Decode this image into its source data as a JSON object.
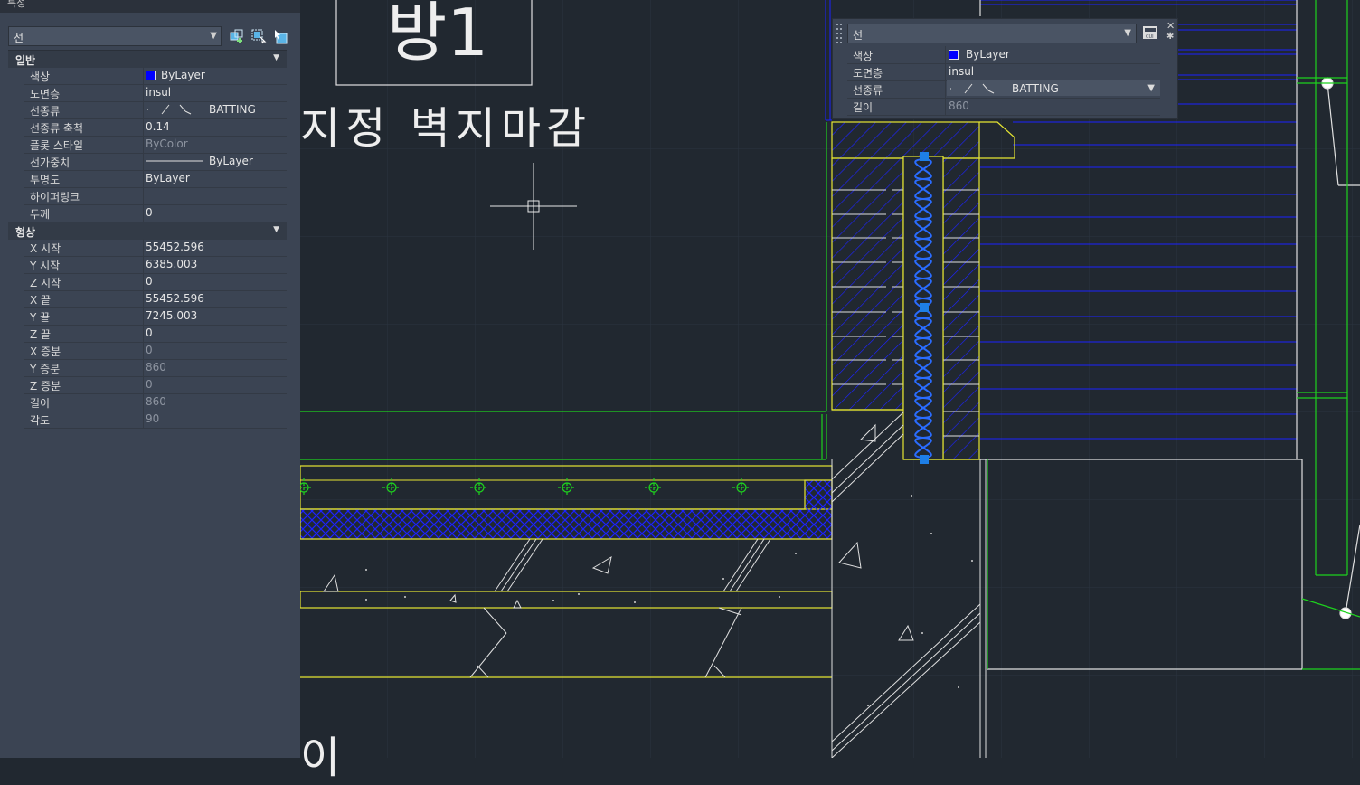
{
  "drawing": {
    "room_label": "방1",
    "wall_note": "지정 벽지마감",
    "partial_bottom_text": "이",
    "colors": {
      "background": "#212830",
      "layer_blue": "#1c22ff",
      "layer_yellow": "#e6e632",
      "layer_green": "#1ed21e",
      "white_lines": "#e0e0e0",
      "grip": "#1e7fe6"
    }
  },
  "properties_palette": {
    "title": "특성",
    "object_type": "선",
    "toolbar_icons": [
      "toggle-pickadd-icon",
      "select-objects-icon",
      "quick-select-icon"
    ],
    "sections": [
      {
        "label": "일반",
        "rows": [
          {
            "key": "색상",
            "value": "ByLayer",
            "swatch": "#0000ff"
          },
          {
            "key": "도면층",
            "value": "insul"
          },
          {
            "key": "선종류",
            "value": "BATTING",
            "linetype_preview": true
          },
          {
            "key": "선종류 축척",
            "value": "0.14"
          },
          {
            "key": "플롯 스타일",
            "value": "ByColor",
            "dim": true
          },
          {
            "key": "선가중치",
            "value": "ByLayer",
            "lineweight_preview": true
          },
          {
            "key": "투명도",
            "value": "ByLayer"
          },
          {
            "key": "하이퍼링크",
            "value": ""
          },
          {
            "key": "두께",
            "value": "0"
          }
        ]
      },
      {
        "label": "형상",
        "rows": [
          {
            "key": "X 시작",
            "value": "55452.596"
          },
          {
            "key": "Y 시작",
            "value": "6385.003"
          },
          {
            "key": "Z 시작",
            "value": "0"
          },
          {
            "key": "X 끝",
            "value": "55452.596"
          },
          {
            "key": "Y 끝",
            "value": "7245.003"
          },
          {
            "key": "Z 끝",
            "value": "0"
          },
          {
            "key": "X 증분",
            "value": "0",
            "dim": true
          },
          {
            "key": "Y 증분",
            "value": "860",
            "dim": true
          },
          {
            "key": "Z 증분",
            "value": "0",
            "dim": true
          },
          {
            "key": "길이",
            "value": "860",
            "dim": true
          },
          {
            "key": "각도",
            "value": "90",
            "dim": true
          }
        ]
      }
    ]
  },
  "quick_properties": {
    "object_type": "선",
    "rows": [
      {
        "key": "색상",
        "value": "ByLayer",
        "swatch": "#0000ff"
      },
      {
        "key": "도면층",
        "value": "insul"
      },
      {
        "key": "선종류",
        "value": "BATTING",
        "linetype_preview": true,
        "active": true
      },
      {
        "key": "길이",
        "value": "860",
        "dim": true
      }
    ]
  }
}
